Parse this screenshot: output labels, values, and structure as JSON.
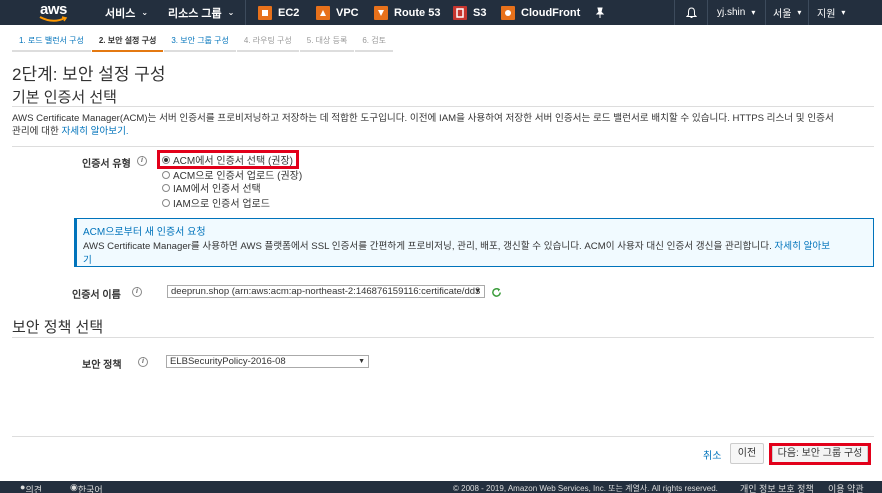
{
  "nav": {
    "logo": "aws",
    "services": "서비스",
    "resource_groups": "리소스 그룹",
    "shortcuts": [
      {
        "label": "EC2",
        "color": "#e7711b"
      },
      {
        "label": "VPC",
        "color": "#e7711b"
      },
      {
        "label": "Route 53",
        "color": "#e7711b"
      },
      {
        "label": "S3",
        "color": "#c7362f"
      },
      {
        "label": "CloudFront",
        "color": "#e7711b"
      }
    ],
    "user": "yj.shin",
    "region": "서울",
    "support": "지원"
  },
  "wizard": {
    "steps": [
      "1. 로드 밸런서 구성",
      "2. 보안 설정 구성",
      "3. 보안 그룹 구성",
      "4. 라우팅 구성",
      "5. 대상 등록",
      "6. 검토"
    ]
  },
  "page": {
    "title": "2단계: 보안 설정 구성",
    "cert_section_title": "기본 인증서 선택",
    "desc_line1": "AWS Certificate Manager(ACM)는 서버 인증서를 프로비저닝하고 저장하는 데 적합한 도구입니다. 이전에 IAM을 사용하여 저장한 서버 인증서는 로드 밸런서로 배치할 수 있습니다. HTTPS 리스너 및 인증서",
    "desc_line2_prefix": "관리에 대한",
    "desc_link": "자세히 알아보기.",
    "cert_type_label": "인증서 유형",
    "cert_options": [
      "ACM에서 인증서 선택 (권장)",
      "ACM으로 인증서 업로드 (권장)",
      "IAM에서 인증서 선택",
      "IAM으로 인증서 업로드"
    ],
    "info_title": "ACM으로부터 새 인증서 요청",
    "info_body": "AWS Certificate Manager를 사용하면 AWS 플랫폼에서 SSL 인증서를 간편하게 프로비저닝, 관리, 배포, 갱신할 수 있습니다. ACM이 사용자 대신 인증서 갱신을 관리합니다.",
    "info_link_1": "자세히 알아보",
    "info_link_2": "기",
    "cert_name_label": "인증서 이름",
    "cert_name_value": "deeprun.shop (arn:aws:acm:ap-northeast-2:146876159116:certificate/dd3",
    "policy_section_title": "보안 정책 선택",
    "policy_label": "보안 정책",
    "policy_value": "ELBSecurityPolicy-2016-08"
  },
  "actions": {
    "cancel": "취소",
    "previous": "이전",
    "next": "다음: 보안 그룹 구성"
  },
  "footer": {
    "feedback": "의견",
    "language": "한국어",
    "copyright": "© 2008 - 2019, Amazon Web Services, Inc. 또는 계열사. All rights reserved.",
    "privacy": "개인 정보 보호 정책",
    "terms": "이용 약관"
  }
}
